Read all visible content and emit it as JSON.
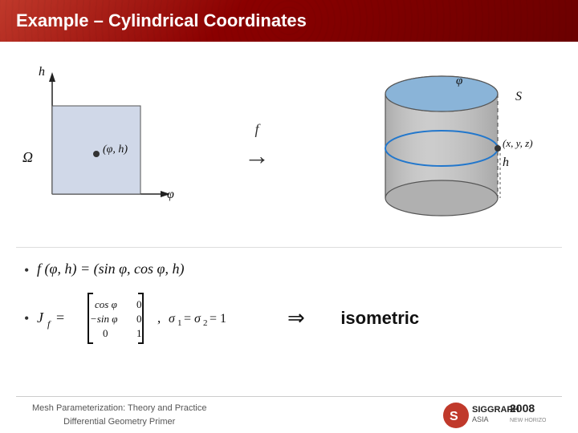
{
  "header": {
    "title": "Example – Cylindrical Coordinates"
  },
  "arrow": {
    "f_label": "f",
    "arrow_symbol": "→"
  },
  "bullet1": {
    "bullet": "•",
    "formula_html": "f(φ, h) = (sin φ, cos φ, h)"
  },
  "bullet2": {
    "bullet": "•",
    "J_label": "J",
    "sub_f": "f",
    "sigma_formula": ",   σ₁ = σ₂ = 1"
  },
  "isometric": {
    "implies": "⇒",
    "label": "isometric"
  },
  "footer": {
    "line1": "Mesh Parameterization: Theory and Practice",
    "line2": "Differential Geometry Primer"
  },
  "left_diagram": {
    "omega_label": "Ω",
    "h_label": "h",
    "phi_label": "φ",
    "point_label": "(φ, h)"
  },
  "right_diagram": {
    "phi_label": "φ",
    "S_label": "S",
    "h_label": "h",
    "point_label": "(x, y, z)"
  },
  "matrix": {
    "rows": [
      [
        "cos φ",
        "0"
      ],
      [
        "−sin φ",
        "0"
      ],
      [
        "0",
        "1"
      ]
    ]
  }
}
